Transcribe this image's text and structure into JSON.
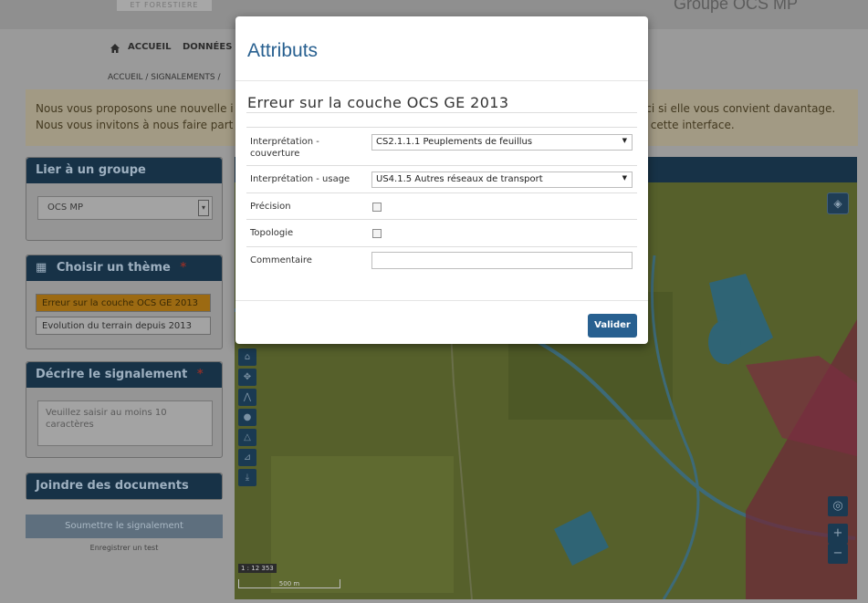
{
  "colors": {
    "accent": "#286090",
    "panel_head": "#173247",
    "map_bg": "#535b2a",
    "selected_theme": "#9c6a12"
  },
  "header": {
    "logo_text": "ET FORESTIERE",
    "group_title": "Groupe OCS MP",
    "nav": {
      "home": "ACCUEIL",
      "data": "DONNÉES ▾"
    }
  },
  "breadcrumb": "ACCUEIL / SIGNALEMENTS /",
  "info": {
    "line1_left": "Nous vous proposons une nouvelle i",
    "line1_right": "ici si elle vous convient davantage.",
    "line2_left": "Nous vous invitons à nous faire part",
    "line2_right": "r cette interface."
  },
  "sidebar": {
    "group_panel": {
      "title": "Lier à un groupe",
      "selected": "OCS MP"
    },
    "theme_panel": {
      "title": "Choisir un thème",
      "required_mark": "*",
      "themes": [
        {
          "label": "Erreur sur la couche OCS GE 2013"
        },
        {
          "label": "Evolution du terrain depuis 2013"
        }
      ]
    },
    "describe_panel": {
      "title": "Décrire le signalement",
      "required_mark": "*",
      "placeholder": "Veuillez saisir au moins 10 caractères"
    },
    "documents_panel": {
      "title": "Joindre des documents"
    },
    "submit": "Soumettre le signalement",
    "test_link": "Enregistrer un test"
  },
  "map": {
    "scale_ratio": "1 : 12 353",
    "scale_bar": "500 m",
    "zoom_in": "+",
    "zoom_out": "−"
  },
  "modal": {
    "title": "Attributs",
    "section": "Erreur sur la couche OCS GE 2013",
    "fields": {
      "couverture": {
        "label": "Interprétation - couverture",
        "value": "CS2.1.1.1 Peuplements de feuillus"
      },
      "usage": {
        "label": "Interprétation - usage",
        "value": "US4.1.5 Autres réseaux de transport"
      },
      "precision": {
        "label": "Précision",
        "checked": false
      },
      "topologie": {
        "label": "Topologie",
        "checked": false
      },
      "commentaire": {
        "label": "Commentaire",
        "value": ""
      }
    },
    "submit": "Valider"
  }
}
